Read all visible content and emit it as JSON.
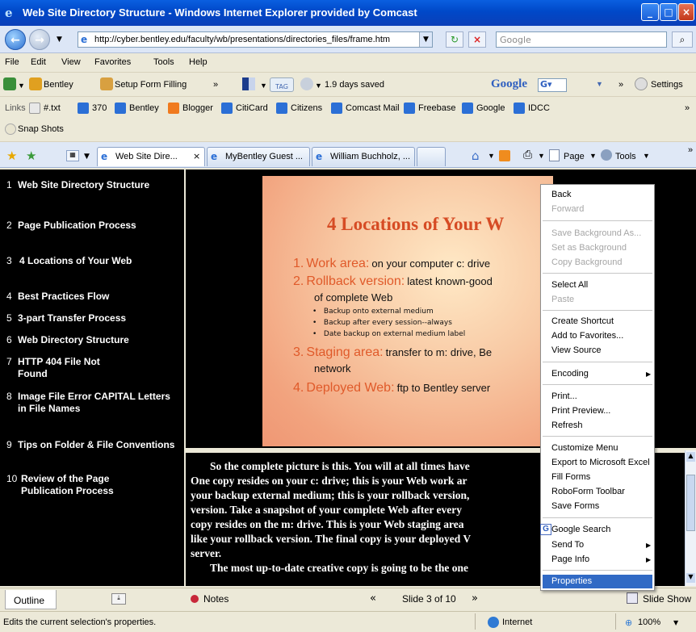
{
  "window": {
    "title": "Web Site Directory Structure - Windows Internet Explorer provided by Comcast"
  },
  "address": {
    "url": "http://cyber.bentley.edu/faculty/wb/presentations/directories_files/frame.htm",
    "search_placeholder": "Google"
  },
  "menu": [
    "File",
    "Edit",
    "View",
    "Favorites",
    "Tools",
    "Help"
  ],
  "google_toolbar": {
    "bentley": "Bentley",
    "setup_form": "Setup Form Filling",
    "tag": "TAG",
    "saved": "1.9 days saved",
    "google": "Google",
    "settings": "Settings"
  },
  "links": {
    "label": "Links",
    "items": [
      "#.txt",
      "370",
      "Bentley",
      "Blogger",
      "CitiCard",
      "Citizens",
      "Comcast Mail",
      "Freebase",
      "Google",
      "IDCC"
    ],
    "snapshots": "Snap Shots"
  },
  "tabs": [
    "Web Site Dire...",
    "MyBentley Guest ...",
    "William Buchholz, ..."
  ],
  "commands": {
    "page": "Page",
    "tools": "Tools"
  },
  "outline": [
    {
      "num": "1",
      "text": "Web Site Directory Structure"
    },
    {
      "num": "2",
      "text": "Page Publication Process"
    },
    {
      "num": "3",
      "text": "4 Locations of Your Web"
    },
    {
      "num": "4",
      "text": "Best Practices Flow"
    },
    {
      "num": "5",
      "text": "3-part Transfer Process"
    },
    {
      "num": "6",
      "text": "Web Directory Structure"
    },
    {
      "num": "7",
      "text": "HTTP 404 File Not Found"
    },
    {
      "num": "8",
      "text": "Image File Error CAPITAL Letters in File Names"
    },
    {
      "num": "9",
      "text": "Tips on Folder & File Conventions"
    },
    {
      "num": "10",
      "text": "Review of the Page Publication Process"
    }
  ],
  "slide": {
    "title": "4 Locations of Your W",
    "items": [
      {
        "n": "1.",
        "head": "Work area:",
        "body": "on your computer c: drive"
      },
      {
        "n": "2.",
        "head": "Rollback version:",
        "body": "latest known-good",
        "body2": "of complete Web"
      },
      {
        "n": "3.",
        "head": "Staging area:",
        "body": "transfer to m: drive, Be",
        "body2": "network"
      },
      {
        "n": "4.",
        "head": "Deployed Web:",
        "body": "ftp to Bentley server"
      }
    ],
    "bullets": [
      "Backup onto external medium",
      "Backup after every session--always",
      "Date backup on external medium label"
    ]
  },
  "notes": {
    "lines": [
      "So the complete picture is this. You will at all times have",
      "One copy resides on your c: drive; this is your Web work ar",
      "your backup external medium; this is your rollback version,",
      "version. Take a snapshot of your complete Web after every",
      "copy resides on the m: drive. This is your Web staging area",
      "like your rollback version. The final copy is your deployed V",
      "server.",
      "The most up-to-date creative copy is going to be the one"
    ]
  },
  "bottom": {
    "outline_tab": "Outline",
    "notes": "Notes",
    "slide_counter": "Slide 3 of 10",
    "slideshow": "Slide Show"
  },
  "status": {
    "text": "Edits the current selection's properties.",
    "zone": "Internet",
    "zoom": "100%"
  },
  "context_menu": [
    {
      "label": "Back",
      "disabled": false
    },
    {
      "label": "Forward",
      "disabled": true
    },
    {
      "label": "Save Background As...",
      "disabled": true
    },
    {
      "label": "Set as Background",
      "disabled": true
    },
    {
      "label": "Copy Background",
      "disabled": true
    },
    {
      "label": "Select All",
      "disabled": false
    },
    {
      "label": "Paste",
      "disabled": true
    },
    {
      "label": "Create Shortcut",
      "disabled": false
    },
    {
      "label": "Add to Favorites...",
      "disabled": false
    },
    {
      "label": "View Source",
      "disabled": false
    },
    {
      "label": "Encoding",
      "disabled": false
    },
    {
      "label": "Print...",
      "disabled": false
    },
    {
      "label": "Print Preview...",
      "disabled": false
    },
    {
      "label": "Refresh",
      "disabled": false
    },
    {
      "label": "Customize Menu",
      "disabled": false
    },
    {
      "label": "Export to Microsoft Excel",
      "disabled": false
    },
    {
      "label": "Fill Forms",
      "disabled": false
    },
    {
      "label": "RoboForm Toolbar",
      "disabled": false
    },
    {
      "label": "Save Forms",
      "disabled": false
    },
    {
      "label": "Google Search",
      "disabled": false
    },
    {
      "label": "Send To",
      "disabled": false
    },
    {
      "label": "Page Info",
      "disabled": false
    },
    {
      "label": "Properties",
      "disabled": false
    }
  ]
}
